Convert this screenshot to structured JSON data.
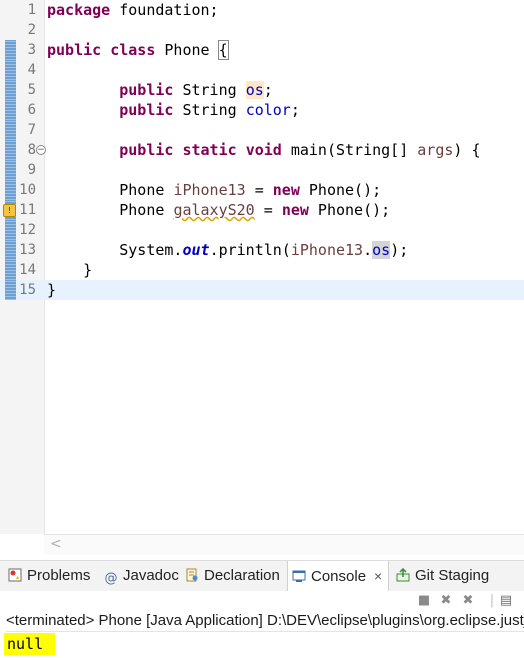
{
  "editor": {
    "lines": [
      {
        "num": "1",
        "parts": [
          {
            "t": "package",
            "c": "kw"
          },
          {
            "t": " foundation;"
          }
        ]
      },
      {
        "num": "2",
        "parts": []
      },
      {
        "num": "3",
        "parts": [
          {
            "t": "public",
            "c": "kw"
          },
          {
            "t": " "
          },
          {
            "t": "class",
            "c": "kw"
          },
          {
            "t": " Phone "
          },
          {
            "t": "{",
            "c": "bracket"
          }
        ]
      },
      {
        "num": "4",
        "parts": []
      },
      {
        "num": "5",
        "parts": [
          {
            "t": "        "
          },
          {
            "t": "public",
            "c": "kw"
          },
          {
            "t": " String "
          },
          {
            "t": "os",
            "c": "fld osdecl"
          },
          {
            "t": ";"
          }
        ]
      },
      {
        "num": "6",
        "parts": [
          {
            "t": "        "
          },
          {
            "t": "public",
            "c": "kw"
          },
          {
            "t": " String "
          },
          {
            "t": "color",
            "c": "fld"
          },
          {
            "t": ";"
          }
        ]
      },
      {
        "num": "7",
        "parts": []
      },
      {
        "num": "8",
        "parts": [
          {
            "t": "        "
          },
          {
            "t": "public",
            "c": "kw"
          },
          {
            "t": " "
          },
          {
            "t": "static",
            "c": "kw"
          },
          {
            "t": " "
          },
          {
            "t": "void",
            "c": "kw"
          },
          {
            "t": " main(String[] "
          },
          {
            "t": "args",
            "c": "var"
          },
          {
            "t": ") {"
          }
        ]
      },
      {
        "num": "9",
        "parts": []
      },
      {
        "num": "10",
        "parts": [
          {
            "t": "        Phone "
          },
          {
            "t": "iPhone13",
            "c": "var"
          },
          {
            "t": " = "
          },
          {
            "t": "new",
            "c": "kw"
          },
          {
            "t": " Phone();"
          }
        ]
      },
      {
        "num": "11",
        "parts": [
          {
            "t": "        Phone "
          },
          {
            "t": "galaxyS20",
            "c": "unused"
          },
          {
            "t": " = "
          },
          {
            "t": "new",
            "c": "kw"
          },
          {
            "t": " Phone();"
          }
        ]
      },
      {
        "num": "12",
        "parts": []
      },
      {
        "num": "13",
        "parts": [
          {
            "t": "        System."
          },
          {
            "t": "out",
            "c": "sfld"
          },
          {
            "t": ".println("
          },
          {
            "t": "iPhone13",
            "c": "var"
          },
          {
            "t": "."
          },
          {
            "t": "os",
            "c": "fld occhl"
          },
          {
            "t": ");"
          }
        ]
      },
      {
        "num": "14",
        "parts": [
          {
            "t": "    }"
          }
        ]
      },
      {
        "num": "15",
        "parts": [
          {
            "t": "}"
          }
        ]
      }
    ]
  },
  "scrollbar": {
    "left_arrow": "<"
  },
  "tabs": [
    {
      "label": "Problems",
      "icon": "problems-icon"
    },
    {
      "label": "Javadoc",
      "icon": "javadoc-icon",
      "glyph": "@"
    },
    {
      "label": "Declaration",
      "icon": "declaration-icon"
    },
    {
      "label": "Console",
      "icon": "console-icon",
      "close": "×"
    },
    {
      "label": "Git Staging",
      "icon": "git-staging-icon"
    }
  ],
  "console": {
    "description": "<terminated> Phone [Java Application] D:\\DEV\\eclipse\\plugins\\org.eclipse.justj.openjdk",
    "output": "null"
  },
  "colors": {
    "keyword": "#7f0055",
    "field": "#0000c0",
    "local_variable": "#6a3e3e",
    "current_line": "#e8f2fe",
    "output_highlight": "#ffff00"
  }
}
